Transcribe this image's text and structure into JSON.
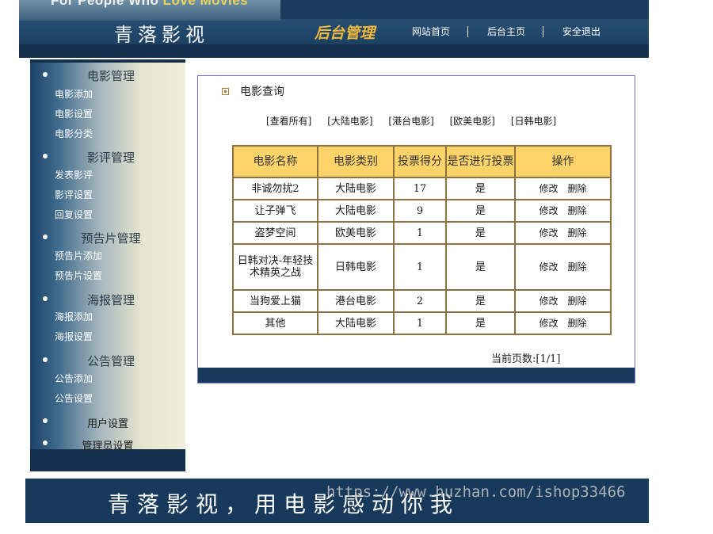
{
  "header": {
    "slogan_prefix": "For People Who ",
    "slogan_highlight": "Love Movies",
    "site_name": "青落影视",
    "admin_title": "后台管理",
    "nav": {
      "home": "网站首页",
      "admin_home": "后台主页",
      "logout": "安全退出"
    }
  },
  "sidebar": {
    "sections": [
      {
        "title": "电影管理",
        "items": [
          "电影添加",
          "电影设置",
          "电影分类"
        ]
      },
      {
        "title": "影评管理",
        "items": [
          "发表影评",
          "影评设置",
          "回复设置"
        ]
      },
      {
        "title": "预告片管理",
        "items": [
          "预告片添加",
          "预告片设置"
        ]
      },
      {
        "title": "海报管理",
        "items": [
          "海报添加",
          "海报设置"
        ]
      },
      {
        "title": "公告管理",
        "items": [
          "公告添加",
          "公告设置"
        ]
      },
      {
        "title": "用户设置",
        "items": []
      },
      {
        "title": "管理员设置",
        "items": []
      }
    ]
  },
  "main": {
    "title": "电影查询",
    "filters": [
      "[查看所有]",
      "[大陆电影]",
      "[港台电影]",
      "[欧美电影]",
      "[日韩电影]"
    ],
    "table": {
      "headers": [
        "电影名称",
        "电影类别",
        "投票得分",
        "是否进行投票",
        "操作"
      ],
      "rows": [
        {
          "name": "非诚勿扰2",
          "category": "大陆电影",
          "score": "17",
          "voting": "是"
        },
        {
          "name": "让子弹飞",
          "category": "大陆电影",
          "score": "9",
          "voting": "是"
        },
        {
          "name": "盗梦空间",
          "category": "欧美电影",
          "score": "1",
          "voting": "是"
        },
        {
          "name": "日韩对决-年轻技术精英之战",
          "category": "日韩电影",
          "score": "1",
          "voting": "是"
        },
        {
          "name": "当狗爱上猫",
          "category": "港台电影",
          "score": "2",
          "voting": "是"
        },
        {
          "name": "其他",
          "category": "大陆电影",
          "score": "1",
          "voting": "是"
        }
      ],
      "edit_label": "修改",
      "delete_label": "删除"
    },
    "pager": "当前页数:[1/1]"
  },
  "banner": {
    "text": "青落影视，用电影感动你我"
  },
  "watermark": "https://www.huzhan.com/ishop33466"
}
